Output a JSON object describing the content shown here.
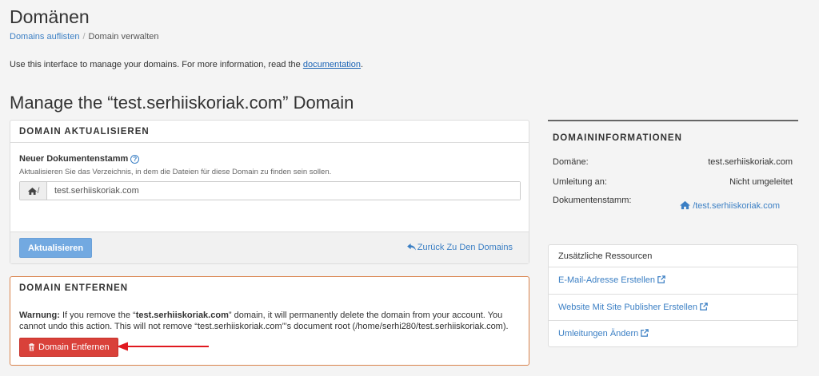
{
  "page": {
    "title": "Domänen",
    "breadcrumb": {
      "link": "Domains auflisten",
      "separator": "/",
      "current": "Domain verwalten"
    },
    "intro": {
      "text": "Use this interface to manage your domains. For more information, read the ",
      "link": "documentation",
      "suffix": "."
    },
    "manage_title": "Manage the “test.serhiiskoriak.com” Domain"
  },
  "update_panel": {
    "heading": "Domain aktualisieren",
    "field_label": "Neuer Dokumentenstamm",
    "field_help": "Aktualisieren Sie das Verzeichnis, in dem die Dateien für diese Domain zu finden sein sollen.",
    "addon_text": "/",
    "input_value": "test.serhiiskoriak.com",
    "submit_label": "Aktualisieren",
    "back_label": "Zurück Zu Den Domains"
  },
  "remove_panel": {
    "heading": "Domain entfernen",
    "warning_label": "Warnung:",
    "warning_part1": " If you remove the “",
    "warning_domain": "test.serhiiskoriak.com",
    "warning_part2": "” domain, it will permanently delete the domain from your account. You cannot undo this action. This will not remove “test.serhiiskoriak.com”’s document root (/home/serhi280/test.serhiiskoriak.com).",
    "button_label": "Domain Entfernen"
  },
  "info_panel": {
    "heading": "Domaininformationen",
    "rows": [
      {
        "label": "Domäne:",
        "value": "test.serhiiskoriak.com"
      },
      {
        "label": "Umleitung an:",
        "value": "Nicht umgeleitet"
      },
      {
        "label": "Dokumentenstamm:",
        "value": "/test.serhiiskoriak.com"
      }
    ]
  },
  "resources_panel": {
    "heading": "Zusätzliche Ressourcen",
    "items": [
      {
        "label": "E-Mail-Adresse Erstellen"
      },
      {
        "label": "Website Mit Site Publisher Erstellen"
      },
      {
        "label": "Umleitungen Ändern"
      }
    ]
  },
  "colors": {
    "link": "#3b7fc4",
    "primary_button": "#72a9e1",
    "danger_button": "#d9413a",
    "danger_border": "#d9824b",
    "annotation_arrow": "#e0191f"
  },
  "icons": {
    "help": "question-circle-icon",
    "home": "home-icon",
    "back": "reply-arrow-icon",
    "trash": "trash-icon",
    "external": "external-link-icon"
  }
}
